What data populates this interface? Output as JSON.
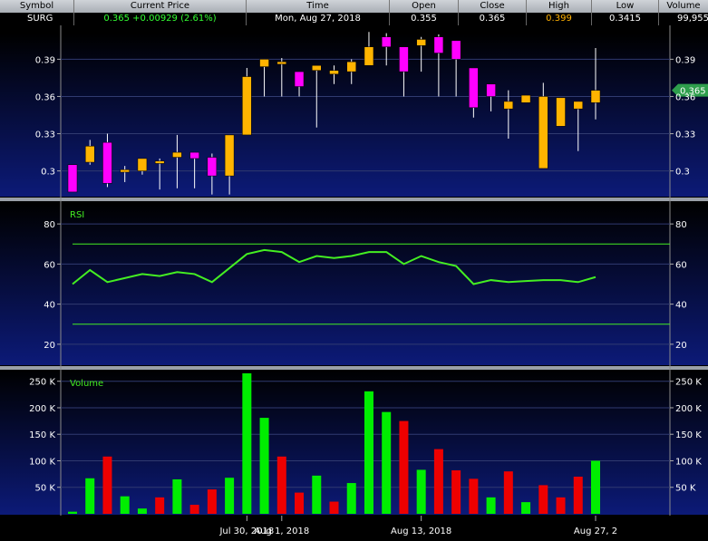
{
  "quote": {
    "headers": [
      "Symbol",
      "Current Price",
      "Time",
      "Open",
      "Close",
      "High",
      "Low",
      "Volume"
    ],
    "symbol": "SURG",
    "price": "0.365",
    "change": "+0.00929 (2.61%)",
    "time": "Mon, Aug 27, 2018",
    "open": "0.355",
    "close": "0.365",
    "high": "0.399",
    "low": "0.3415",
    "volume": "99,955"
  },
  "colors": {
    "up": "#ffb400",
    "down": "#ff00ff",
    "vol_up": "#00ee00",
    "vol_down": "#ee0000",
    "rsi_line": "#44ee22",
    "last_price_tag": "#2e9e4c"
  },
  "chart_data": [
    {
      "type": "candlestick",
      "ylim": [
        0.28,
        0.41
      ],
      "yticks": [
        "0.39",
        "0.36",
        "0.33",
        "0.3"
      ],
      "last_price_label": "0.365",
      "candles": [
        {
          "o": 0.305,
          "c": 0.283,
          "h": 0.305,
          "l": 0.283
        },
        {
          "o": 0.307,
          "c": 0.32,
          "h": 0.325,
          "l": 0.305
        },
        {
          "o": 0.323,
          "c": 0.29,
          "h": 0.33,
          "l": 0.287
        },
        {
          "o": 0.299,
          "c": 0.301,
          "h": 0.304,
          "l": 0.291
        },
        {
          "o": 0.3,
          "c": 0.31,
          "h": 0.31,
          "l": 0.297
        },
        {
          "o": 0.306,
          "c": 0.308,
          "h": 0.31,
          "l": 0.285
        },
        {
          "o": 0.311,
          "c": 0.315,
          "h": 0.329,
          "l": 0.286
        },
        {
          "o": 0.315,
          "c": 0.31,
          "h": 0.315,
          "l": 0.286
        },
        {
          "o": 0.311,
          "c": 0.296,
          "h": 0.314,
          "l": 0.281
        },
        {
          "o": 0.296,
          "c": 0.329,
          "h": 0.329,
          "l": 0.281
        },
        {
          "o": 0.329,
          "c": 0.376,
          "h": 0.383,
          "l": 0.329
        },
        {
          "o": 0.384,
          "c": 0.39,
          "h": 0.39,
          "l": 0.36
        },
        {
          "o": 0.386,
          "c": 0.388,
          "h": 0.391,
          "l": 0.36
        },
        {
          "o": 0.38,
          "c": 0.368,
          "h": 0.38,
          "l": 0.36
        },
        {
          "o": 0.381,
          "c": 0.385,
          "h": 0.385,
          "l": 0.335
        },
        {
          "o": 0.378,
          "c": 0.381,
          "h": 0.385,
          "l": 0.37
        },
        {
          "o": 0.38,
          "c": 0.388,
          "h": 0.39,
          "l": 0.37
        },
        {
          "o": 0.385,
          "c": 0.4,
          "h": 0.412,
          "l": 0.385
        },
        {
          "o": 0.408,
          "c": 0.4,
          "h": 0.411,
          "l": 0.385
        },
        {
          "o": 0.4,
          "c": 0.38,
          "h": 0.4,
          "l": 0.36
        },
        {
          "o": 0.401,
          "c": 0.406,
          "h": 0.408,
          "l": 0.38
        },
        {
          "o": 0.408,
          "c": 0.395,
          "h": 0.41,
          "l": 0.36
        },
        {
          "o": 0.405,
          "c": 0.39,
          "h": 0.405,
          "l": 0.36
        },
        {
          "o": 0.383,
          "c": 0.351,
          "h": 0.383,
          "l": 0.343
        },
        {
          "o": 0.37,
          "c": 0.36,
          "h": 0.37,
          "l": 0.348
        },
        {
          "o": 0.35,
          "c": 0.356,
          "h": 0.365,
          "l": 0.326
        },
        {
          "o": 0.355,
          "c": 0.361,
          "h": 0.361,
          "l": 0.355
        },
        {
          "o": 0.302,
          "c": 0.36,
          "h": 0.371,
          "l": 0.302
        },
        {
          "o": 0.336,
          "c": 0.359,
          "h": 0.359,
          "l": 0.336
        },
        {
          "o": 0.35,
          "c": 0.356,
          "h": 0.356,
          "l": 0.316
        },
        {
          "o": 0.355,
          "c": 0.365,
          "h": 0.399,
          "l": 0.3415
        }
      ]
    },
    {
      "type": "line",
      "title": "RSI",
      "ylim": [
        10,
        90
      ],
      "yticks": [
        "80",
        "60",
        "40",
        "20"
      ],
      "bands": [
        70,
        30
      ],
      "values": [
        50,
        57,
        51,
        53,
        55,
        54,
        56,
        55,
        51,
        58,
        65,
        67,
        66,
        61,
        64,
        63,
        64,
        66,
        66,
        60,
        64,
        61,
        59,
        50,
        52,
        51,
        51.5,
        52,
        52,
        51,
        53.5
      ]
    },
    {
      "type": "bar",
      "title": "Volume",
      "ylim": [
        0,
        270
      ],
      "yticks": [
        "250 K",
        "200 K",
        "150 K",
        "100 K",
        "50 K"
      ],
      "values": [
        4,
        67,
        108,
        33,
        10,
        31,
        65,
        17,
        46,
        68,
        265,
        181,
        108,
        40,
        72,
        23,
        58,
        231,
        192,
        175,
        83,
        122,
        82,
        66,
        31,
        80,
        22,
        54,
        31,
        70,
        100
      ],
      "directions": [
        "up",
        "up",
        "down",
        "up",
        "up",
        "down",
        "up",
        "down",
        "down",
        "up",
        "up",
        "up",
        "down",
        "down",
        "up",
        "down",
        "up",
        "up",
        "up",
        "down",
        "up",
        "down",
        "down",
        "down",
        "up",
        "down",
        "up",
        "down",
        "down",
        "down",
        "up"
      ],
      "xticks": [
        {
          "index": 10,
          "label": "Jul 30, 2018"
        },
        {
          "index": 12,
          "label": "Aug 1, 2018"
        },
        {
          "index": 20,
          "label": "Aug 13, 2018"
        },
        {
          "index": 30,
          "label": "Aug 27, 2"
        }
      ]
    }
  ]
}
